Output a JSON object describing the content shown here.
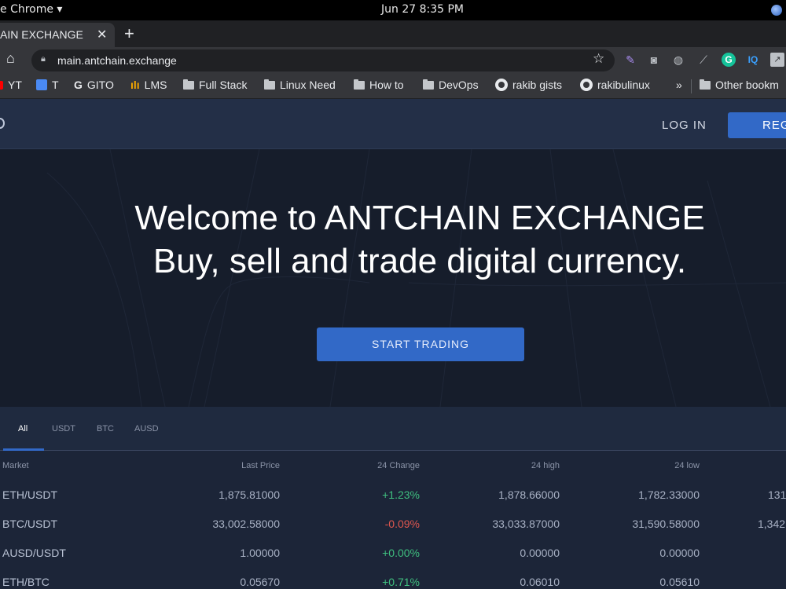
{
  "os": {
    "app_label": "e Chrome ▾",
    "clock": "Jun 27   8:35 PM"
  },
  "browser": {
    "tab_title": "AIN EXCHANGE",
    "tab_close": "✕",
    "new_tab": "+",
    "url": "main.antchain.exchange",
    "bookmarks": [
      "YT",
      "T",
      "GITO",
      "LMS",
      "Full Stack",
      "Linux Need",
      "How to",
      "DevOps",
      "rakib gists",
      "rakibulinux",
      "»",
      "Other bookm"
    ]
  },
  "site": {
    "login_label": "LOG IN",
    "register_label": "REG",
    "headline_line1": "Welcome to ANTCHAIN EXCHANGE",
    "headline_line2": "Buy, sell and trade digital currency.",
    "cta_label": "START TRADING"
  },
  "market": {
    "tabs": [
      "All",
      "USDT",
      "BTC",
      "AUSD"
    ],
    "active_tab": "All",
    "columns": [
      "Market",
      "Last Price",
      "24 Change",
      "24 high",
      "24 low"
    ],
    "rows": [
      {
        "pair": "ETH/USDT",
        "last": "1,875.81000",
        "change": "+1.23%",
        "high": "1,878.66000",
        "low": "1,782.33000",
        "vol": "131"
      },
      {
        "pair": "BTC/USDT",
        "last": "33,002.58000",
        "change": "-0.09%",
        "high": "33,033.87000",
        "low": "31,590.58000",
        "vol": "1,342"
      },
      {
        "pair": "AUSD/USDT",
        "last": "1.00000",
        "change": "+0.00%",
        "high": "0.00000",
        "low": "0.00000",
        "vol": ""
      },
      {
        "pair": "ETH/BTC",
        "last": "0.05670",
        "change": "+0.71%",
        "high": "0.06010",
        "low": "0.05610",
        "vol": ""
      }
    ]
  },
  "colors": {
    "accent": "#3269c7",
    "positive": "#3fbf7f",
    "negative": "#e0574f"
  }
}
